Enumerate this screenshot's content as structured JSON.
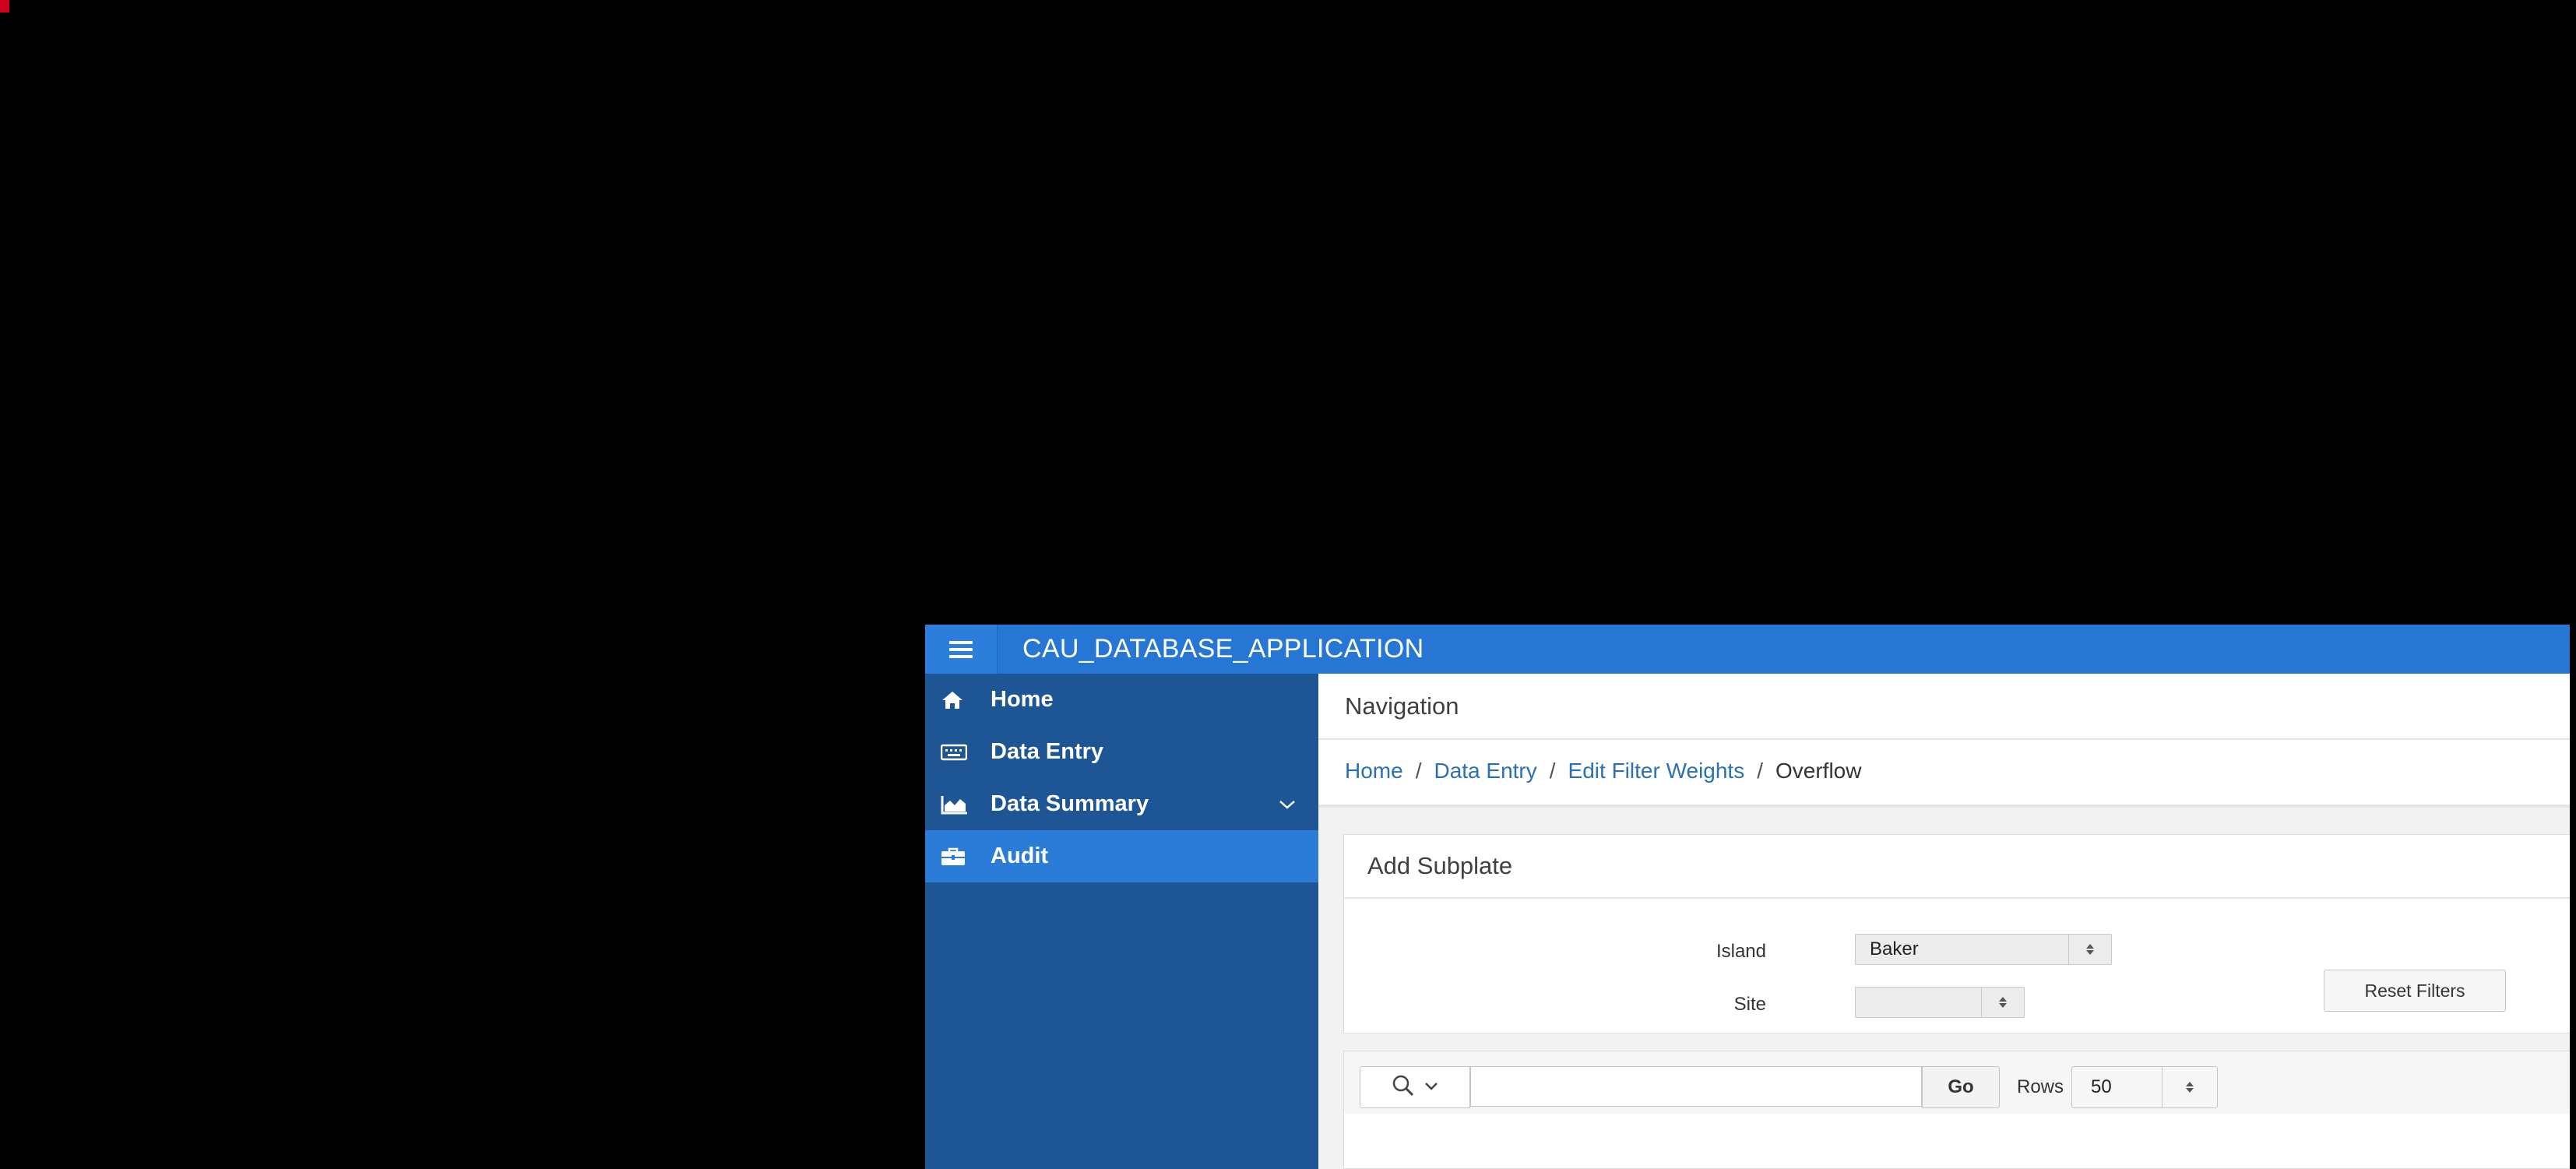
{
  "app": {
    "title": "CAU_DATABASE_APPLICATION",
    "accent_color": "#2677d4",
    "sidebar_color": "#1e5594"
  },
  "sidebar": {
    "items": [
      {
        "label": "Home",
        "icon": "home-icon"
      },
      {
        "label": "Data Entry",
        "icon": "keyboard-icon"
      },
      {
        "label": "Data Summary",
        "icon": "area-chart-icon",
        "expandable": true
      },
      {
        "label": "Audit",
        "icon": "briefcase-icon",
        "active": true
      }
    ]
  },
  "navigation": {
    "title": "Navigation",
    "breadcrumb": [
      {
        "label": "Home",
        "link": true
      },
      {
        "label": "Data Entry",
        "link": true
      },
      {
        "label": "Edit Filter Weights",
        "link": true
      },
      {
        "label": "Overflow",
        "link": false
      }
    ],
    "separator": "/"
  },
  "subplate": {
    "title": "Add Subplate",
    "island_label": "Island",
    "island_value": "Baker",
    "site_label": "Site",
    "site_value": "",
    "reset_label": "Reset Filters"
  },
  "report": {
    "search_value": "",
    "go_label": "Go",
    "rows_label": "Rows",
    "rows_value": "50"
  }
}
